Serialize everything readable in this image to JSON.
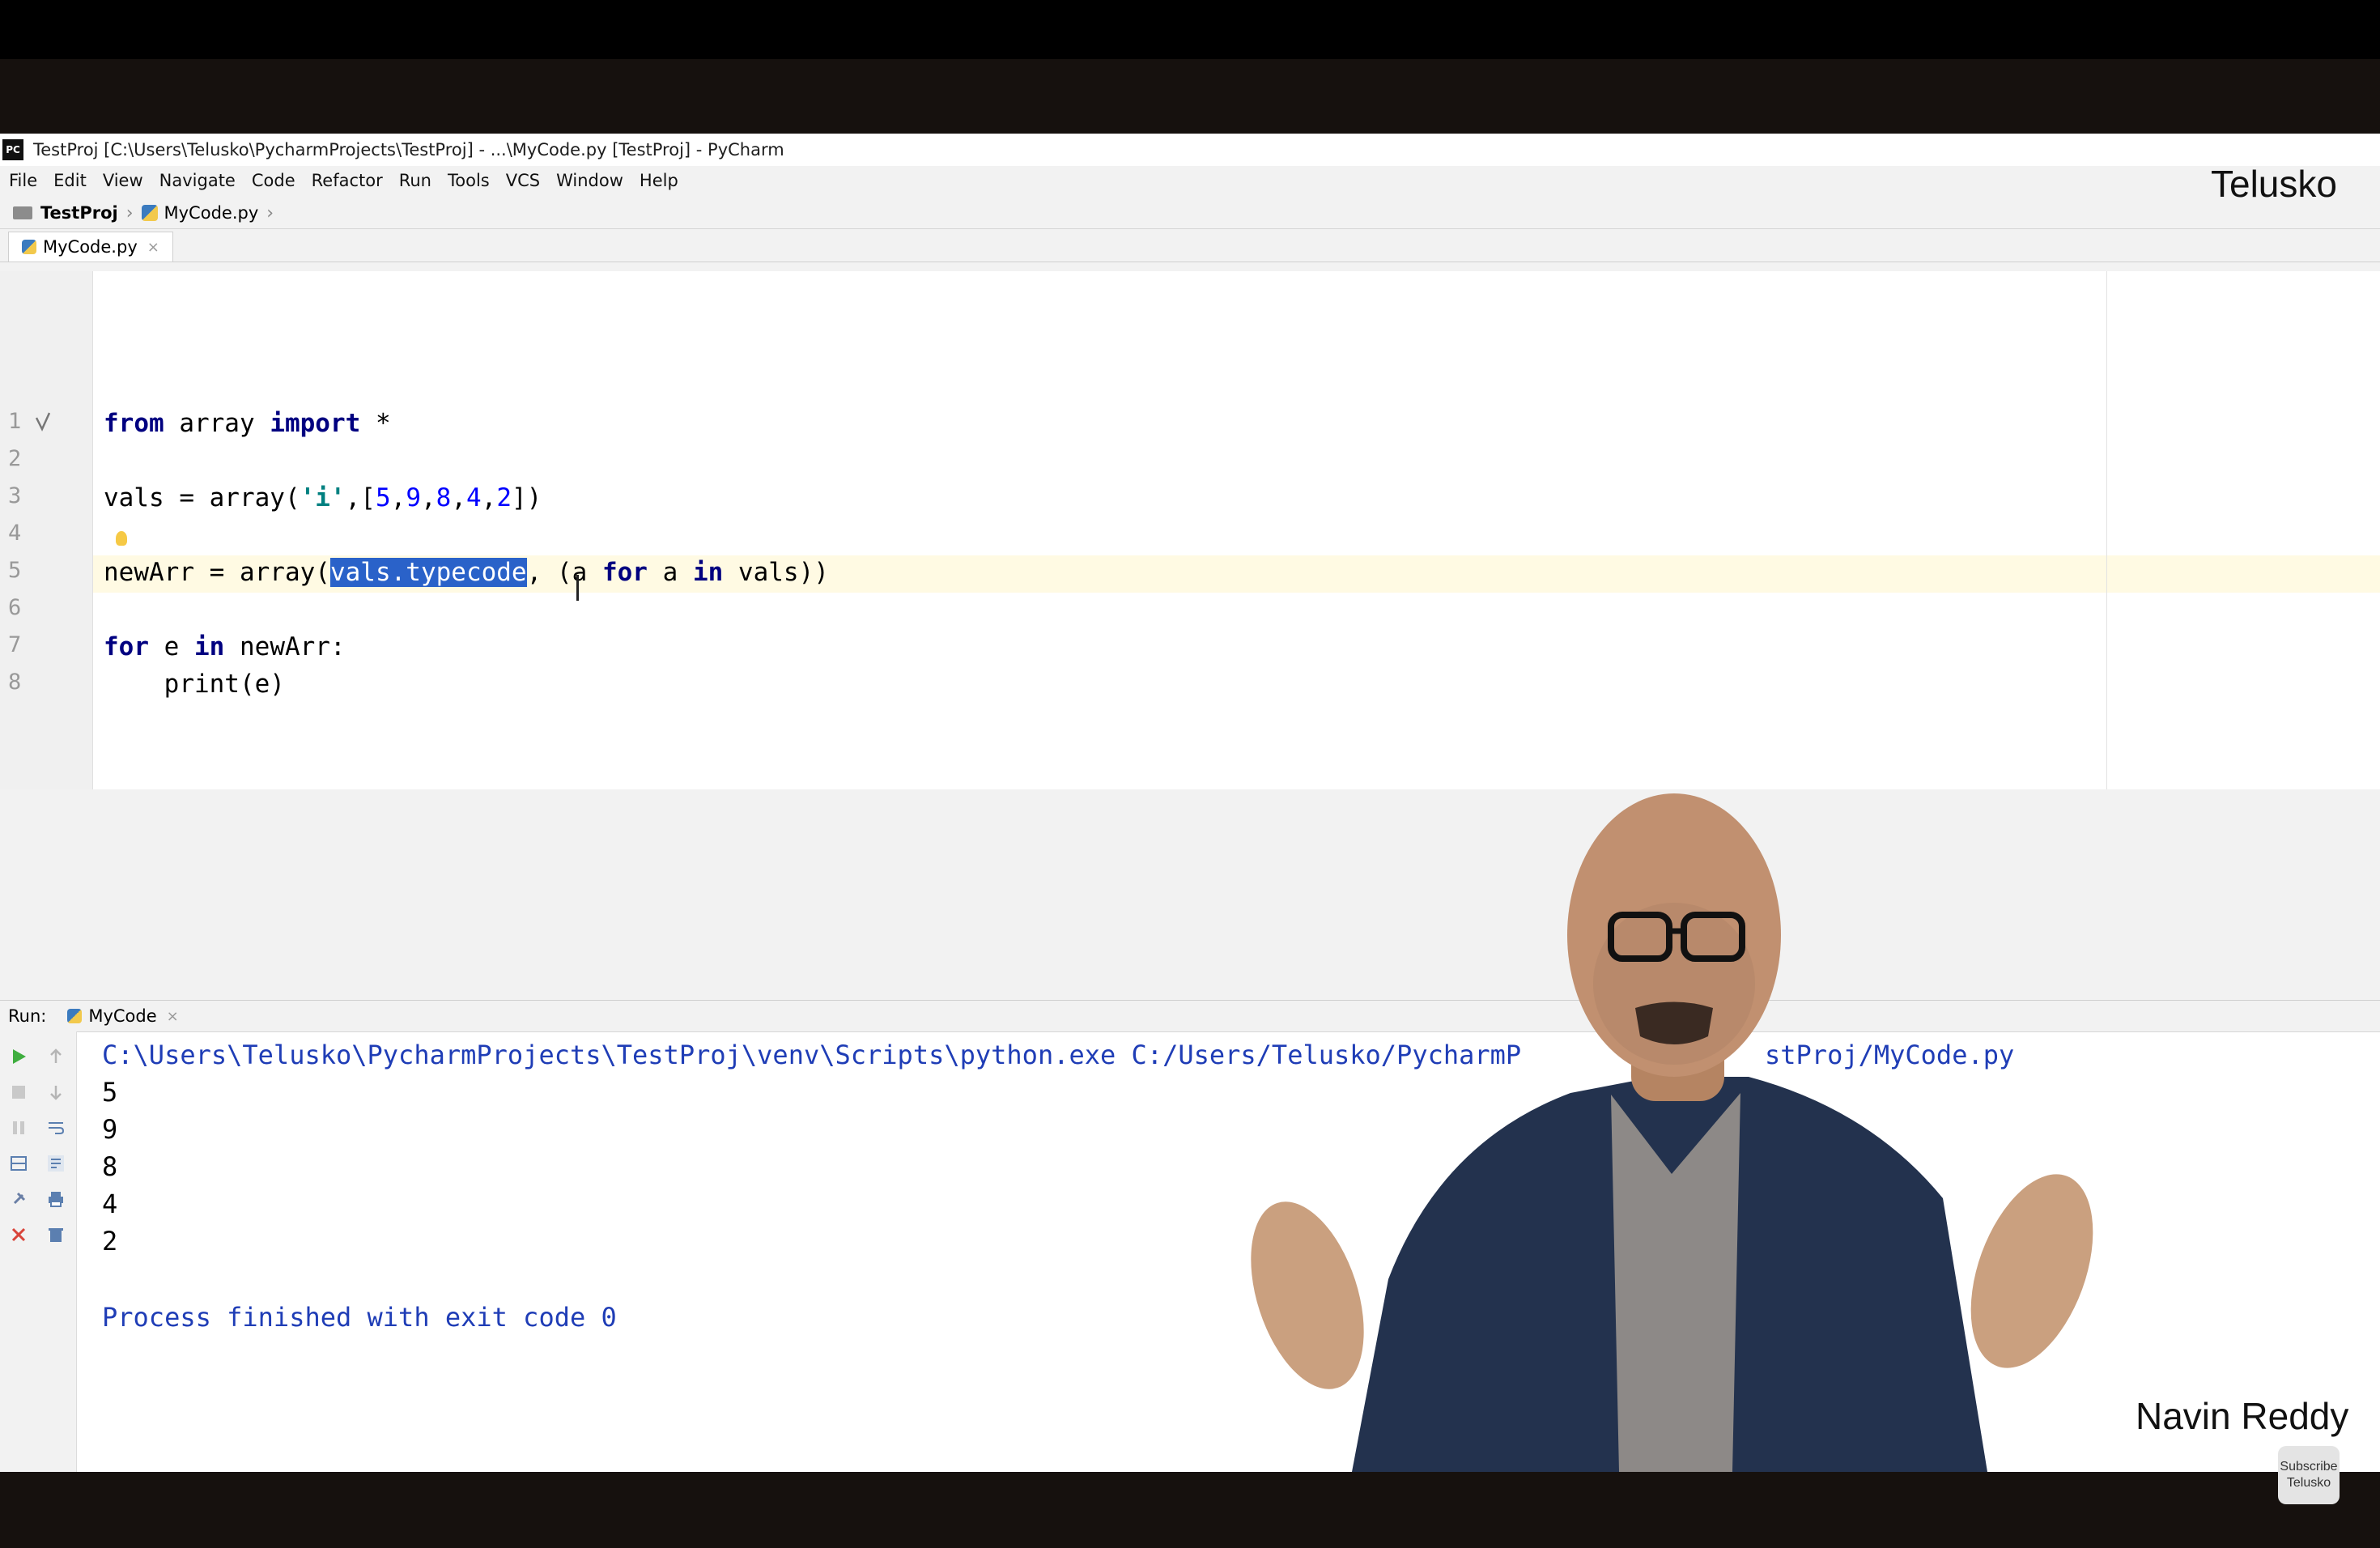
{
  "window": {
    "title": "TestProj [C:\\Users\\Telusko\\PycharmProjects\\TestProj] - ...\\MyCode.py [TestProj] - PyCharm",
    "logo_text": "PC"
  },
  "menu": [
    "File",
    "Edit",
    "View",
    "Navigate",
    "Code",
    "Refactor",
    "Run",
    "Tools",
    "VCS",
    "Window",
    "Help"
  ],
  "breadcrumb": {
    "project": "TestProj",
    "file": "MyCode.py"
  },
  "editor_tab": {
    "label": "MyCode.py",
    "close": "×"
  },
  "editor": {
    "line_numbers": [
      "1",
      "2",
      "3",
      "4",
      "5",
      "6",
      "7",
      "8"
    ],
    "code": {
      "l1_kw1": "from",
      "l1_mid": " array ",
      "l1_kw2": "import",
      "l1_rest": " *",
      "l3_a": "vals = array(",
      "l3_str": "'i'",
      "l3_b": ",[",
      "l3_n1": "5",
      "l3_n2": "9",
      "l3_n3": "8",
      "l3_n4": "4",
      "l3_n5": "2",
      "c": ",",
      "l3_end": "])",
      "l5_a": "newArr = array(",
      "l5_sel": "vals.typecode",
      "l5_b": ", (a ",
      "l5_kw1": "for",
      "l5_c": " a ",
      "l5_kw2": "in",
      "l5_d": " vals))",
      "l7_kw1": "for",
      "l7_a": " e ",
      "l7_kw2": "in",
      "l7_b": " newArr:",
      "l8": "    print(e)"
    }
  },
  "run": {
    "label": "Run:",
    "tab_label": "MyCode",
    "command": "C:\\Users\\Telusko\\PycharmProjects\\TestProj\\venv\\Scripts\\python.exe C:/Users/Telusko/PycharmP",
    "command_tail": "stProj/MyCode.py",
    "output": [
      "5",
      "9",
      "8",
      "4",
      "2"
    ],
    "finish": "Process finished with exit code 0"
  },
  "overlay": {
    "brand": "Telusko",
    "presenter": "Navin Reddy",
    "subscribe_line1": "Subscribe",
    "subscribe_line2": "Telusko"
  },
  "colors": {
    "keyword": "#000080",
    "string": "#008080",
    "number": "#0000ff",
    "selection": "#2a62c9",
    "console_blue": "#1f3db6",
    "run_green": "#3fae3f",
    "stop_red": "#d9443a"
  }
}
